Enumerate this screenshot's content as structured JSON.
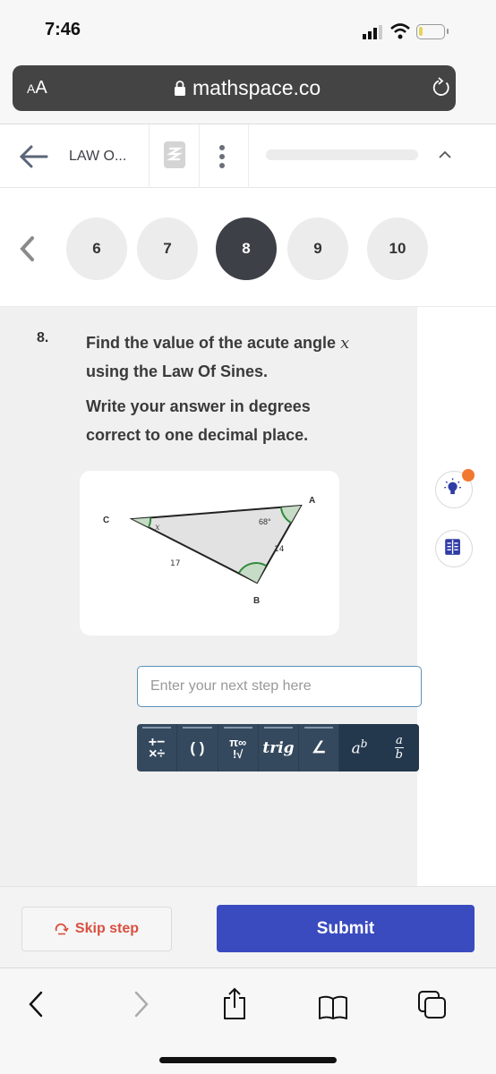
{
  "status_bar": {
    "time": "7:46",
    "battery_color": "#e6d45a"
  },
  "browser": {
    "text_size_label": "AA",
    "url": "mathspace.co"
  },
  "header": {
    "course_title": "LAW O...",
    "progress_fraction": 0.0
  },
  "question_nav": {
    "items": [
      {
        "label": "6",
        "active": false
      },
      {
        "label": "7",
        "active": false
      },
      {
        "label": "8",
        "active": true
      },
      {
        "label": "9",
        "active": false
      },
      {
        "label": "10",
        "active": false
      }
    ]
  },
  "question": {
    "number": "8.",
    "line1": "Find the value of the acute angle",
    "variable": "x",
    "line2": "using the Law Of Sines.",
    "line3": "Write your answer in degrees",
    "line4": "correct to one decimal place."
  },
  "diagram": {
    "vertices": {
      "A": "A",
      "B": "B",
      "C": "C"
    },
    "angle_A": "68°",
    "angle_C": "x",
    "side_AB": "14",
    "side_CB": "17",
    "fill_color": "#e2e2e2",
    "angle_color": "#2e8b3a"
  },
  "input": {
    "placeholder": "Enter your next step here",
    "value": ""
  },
  "math_toolbar": {
    "buttons": [
      {
        "name": "operators",
        "top": "+−",
        "bottom": "×÷"
      },
      {
        "name": "brackets",
        "label": "( )"
      },
      {
        "name": "symbols",
        "top": "π∞",
        "bottom": "!√"
      },
      {
        "name": "trig",
        "label": "trig"
      },
      {
        "name": "angle",
        "label": "∠"
      },
      {
        "name": "power",
        "base": "a",
        "exp": "b"
      },
      {
        "name": "fraction",
        "num": "a",
        "den": "b"
      }
    ]
  },
  "side_tools": {
    "hint_badge_color": "#f27830",
    "icon_color": "#2f3ca6"
  },
  "actions": {
    "skip_label": "Skip step",
    "submit_label": "Submit",
    "submit_color": "#3a4bbf",
    "skip_color": "#d9503f"
  }
}
